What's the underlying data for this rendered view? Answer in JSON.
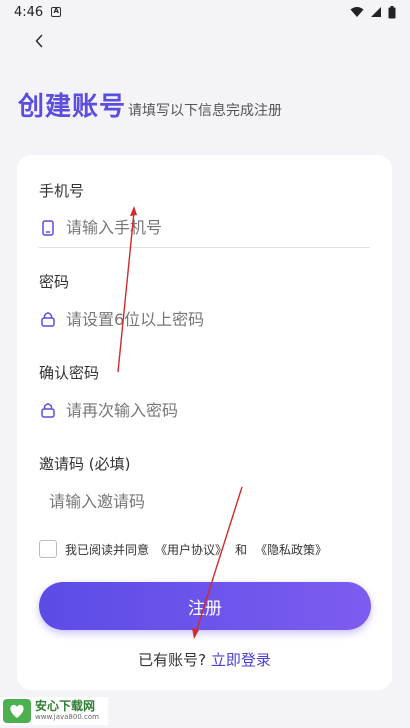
{
  "status_bar": {
    "time": "4:46",
    "notif_glyph": "A"
  },
  "header": {
    "back_icon": "chevron-left-icon",
    "title": "创建账号",
    "subtitle": "请填写以下信息完成注册"
  },
  "form": {
    "phone": {
      "label": "手机号",
      "placeholder": "请输入手机号",
      "icon": "phone-icon"
    },
    "password": {
      "label": "密码",
      "placeholder": "请设置6位以上密码",
      "icon": "lock-icon"
    },
    "confirm": {
      "label": "确认密码",
      "placeholder": "请再次输入密码",
      "icon": "lock-icon"
    },
    "invite": {
      "label": "邀请码 (必填)",
      "placeholder": "请输入邀请码"
    }
  },
  "agreement": {
    "prefix": "我已阅读并同意",
    "user_agreement": "《用户协议》",
    "and": "和",
    "privacy_policy": "《隐私政策》"
  },
  "submit_label": "注册",
  "login": {
    "prompt": "已有账号?",
    "link": "立即登录"
  },
  "watermark": {
    "title": "安心下载网",
    "url": "www.java800.com"
  },
  "colors": {
    "accent": "#5a4de0",
    "annotation": "#d22b2b",
    "background": "#f4f3f8"
  }
}
